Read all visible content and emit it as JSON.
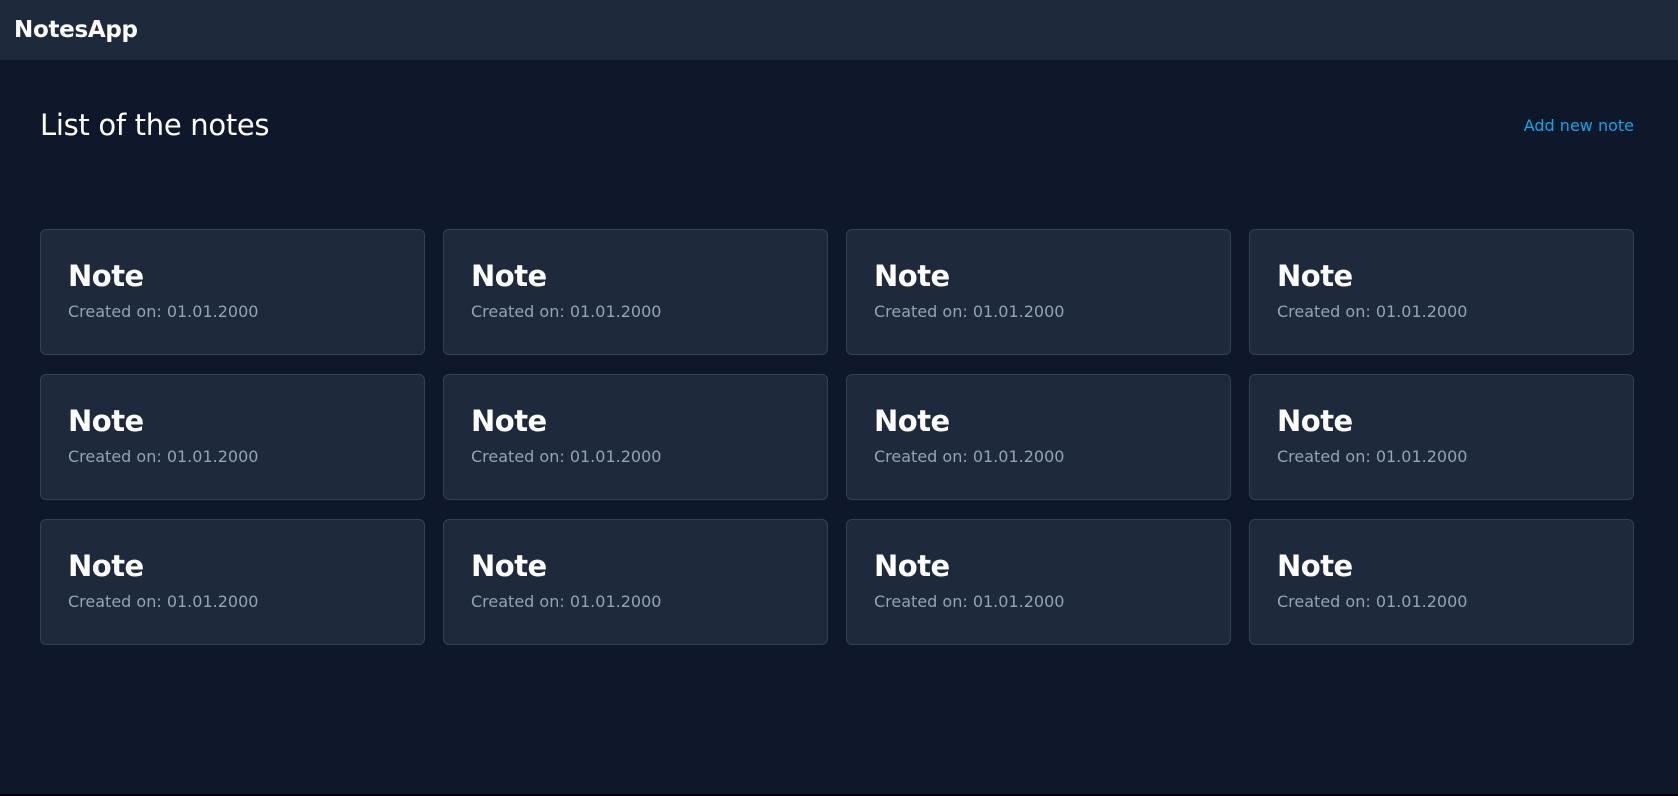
{
  "app": {
    "title": "NotesApp"
  },
  "page": {
    "heading": "List of the notes",
    "add_link": "Add new note"
  },
  "colors": {
    "background": "#0f172a",
    "card": "#1e293b",
    "accent": "#0ea5e9"
  },
  "notes": [
    {
      "title": "Note",
      "created": "Created on: 01.01.2000"
    },
    {
      "title": "Note",
      "created": "Created on: 01.01.2000"
    },
    {
      "title": "Note",
      "created": "Created on: 01.01.2000"
    },
    {
      "title": "Note",
      "created": "Created on: 01.01.2000"
    },
    {
      "title": "Note",
      "created": "Created on: 01.01.2000"
    },
    {
      "title": "Note",
      "created": "Created on: 01.01.2000"
    },
    {
      "title": "Note",
      "created": "Created on: 01.01.2000"
    },
    {
      "title": "Note",
      "created": "Created on: 01.01.2000"
    },
    {
      "title": "Note",
      "created": "Created on: 01.01.2000"
    },
    {
      "title": "Note",
      "created": "Created on: 01.01.2000"
    },
    {
      "title": "Note",
      "created": "Created on: 01.01.2000"
    },
    {
      "title": "Note",
      "created": "Created on: 01.01.2000"
    }
  ]
}
